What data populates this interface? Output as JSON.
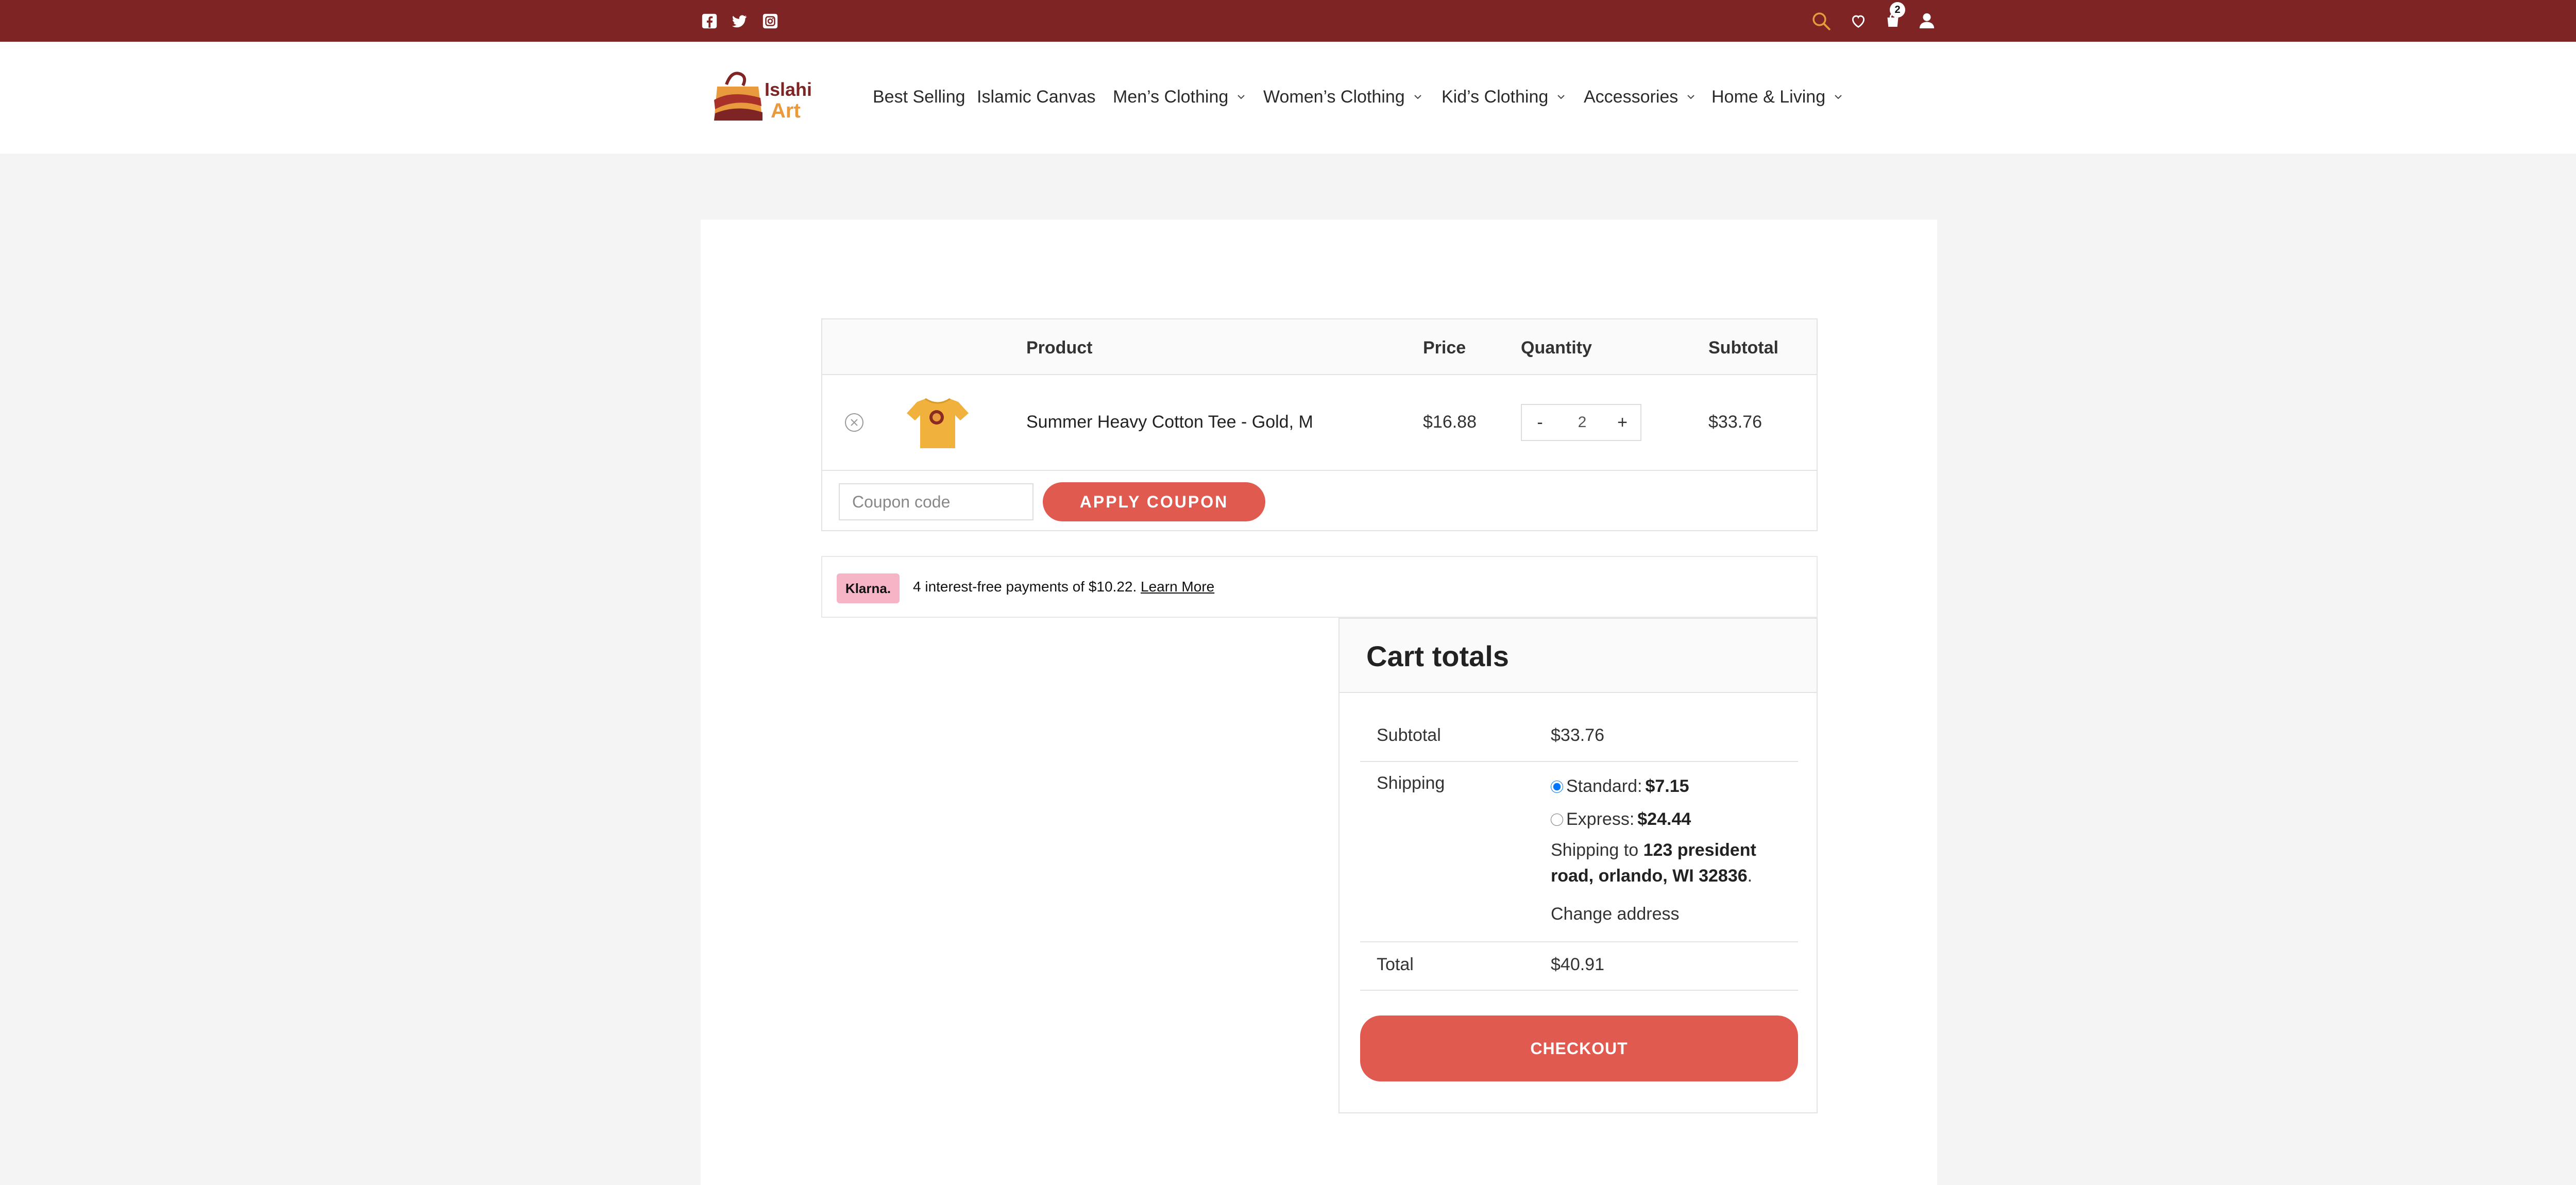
{
  "topbar": {
    "social": [
      {
        "name": "facebook-icon"
      },
      {
        "name": "twitter-icon"
      },
      {
        "name": "instagram-icon"
      }
    ],
    "cart_count": "2",
    "colors": {
      "bar": "#7f2424",
      "search_icon": "#e89a3c"
    }
  },
  "header": {
    "logo_line1": "Islahi",
    "logo_line2": "Art",
    "nav": [
      {
        "label": "Best Selling",
        "dropdown": false
      },
      {
        "label": "Islamic Canvas",
        "dropdown": false
      },
      {
        "label": "Men’s Clothing",
        "dropdown": true
      },
      {
        "label": "Women’s Clothing",
        "dropdown": true
      },
      {
        "label": "Kid’s Clothing",
        "dropdown": true
      },
      {
        "label": "Accessories",
        "dropdown": true
      },
      {
        "label": "Home & Living",
        "dropdown": true
      }
    ]
  },
  "cart": {
    "headers": {
      "product": "Product",
      "price": "Price",
      "quantity": "Quantity",
      "subtotal": "Subtotal"
    },
    "item": {
      "name": "Summer Heavy Cotton Tee - Gold, M",
      "price": "$16.88",
      "quantity": "2",
      "subtotal": "$33.76",
      "qty_minus": "-",
      "qty_plus": "+"
    },
    "coupon_placeholder": "Coupon code",
    "apply_label": "APPLY COUPON",
    "accent": "#e05a50"
  },
  "klarna": {
    "badge": "Klarna.",
    "text": "4 interest-free payments of $10.22.",
    "link": "Learn More",
    "badge_color": "#f5b5c7"
  },
  "totals": {
    "title": "Cart totals",
    "subtotal_label": "Subtotal",
    "subtotal_value": "$33.76",
    "shipping_label": "Shipping",
    "standard_label": "Standard:",
    "standard_price": "$7.15",
    "express_label": "Express:",
    "express_price": "$24.44",
    "selected_option": "Standard",
    "ship_to_prefix": "Shipping to",
    "ship_to_address": "123 president road, orlando, WI 32836",
    "ship_to_suffix": ".",
    "change_address": "Change address",
    "total_label": "Total",
    "total_value": "$40.91",
    "checkout_label": "CHECKOUT"
  }
}
